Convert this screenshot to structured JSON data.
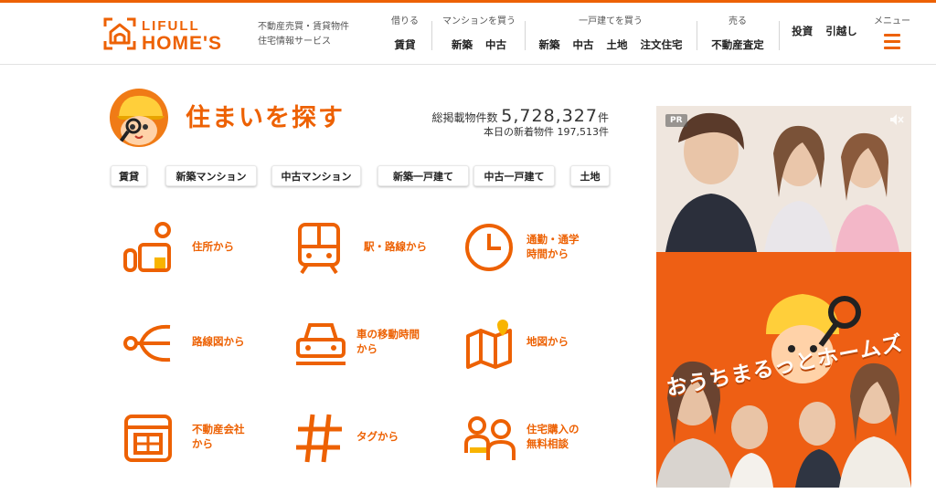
{
  "brand": {
    "line1": "LIFULL",
    "line2": "HOME'S",
    "tagline_1": "不動産売買・賃貸物件",
    "tagline_2": "住宅情報サービス",
    "accent": "#ed6103"
  },
  "nav": [
    {
      "caption": "借りる",
      "links": [
        "賃貸"
      ]
    },
    {
      "caption": "マンションを買う",
      "links": [
        "新築",
        "中古"
      ]
    },
    {
      "caption": "一戸建てを買う",
      "links": [
        "新築",
        "中古",
        "土地",
        "注文住宅"
      ]
    },
    {
      "caption": "売る",
      "links": [
        "不動産査定"
      ]
    },
    {
      "caption": "",
      "links": [
        "投資",
        "引越し"
      ]
    }
  ],
  "menu": {
    "caption": "メニュー",
    "icon": "hamburger-icon"
  },
  "hero": {
    "title": "住まいを探す",
    "total_label": "総掲載物件数",
    "total_value": "5,728,327",
    "total_unit": "件",
    "new_label": "本日の新着物件",
    "new_value": "197,513",
    "new_unit": "件"
  },
  "categories": [
    "賃貸",
    "新築マンション",
    "中古マンション",
    "新築一戸建て",
    "中古一戸建て",
    "土地"
  ],
  "search_tiles": [
    {
      "icon": "address-icon",
      "line1": "住所から",
      "line2": ""
    },
    {
      "icon": "train-icon",
      "line1": "駅・路線から",
      "line2": ""
    },
    {
      "icon": "clock-icon",
      "line1": "通勤・通学",
      "line2": "時間から"
    },
    {
      "icon": "route-map-icon",
      "line1": "路線図から",
      "line2": ""
    },
    {
      "icon": "car-icon",
      "line1": "車の移動時間",
      "line2": "から"
    },
    {
      "icon": "map-icon",
      "line1": "地図から",
      "line2": ""
    },
    {
      "icon": "building-icon",
      "line1": "不動産会社",
      "line2": "から"
    },
    {
      "icon": "hashtag-icon",
      "line1": "タグから",
      "line2": ""
    },
    {
      "icon": "consult-icon",
      "line1": "住宅購入の",
      "line2": "無料相談"
    }
  ],
  "ad": {
    "badge": "PR",
    "catch": "おうちまるっとホームズ",
    "mute_icon": "mute-icon"
  }
}
